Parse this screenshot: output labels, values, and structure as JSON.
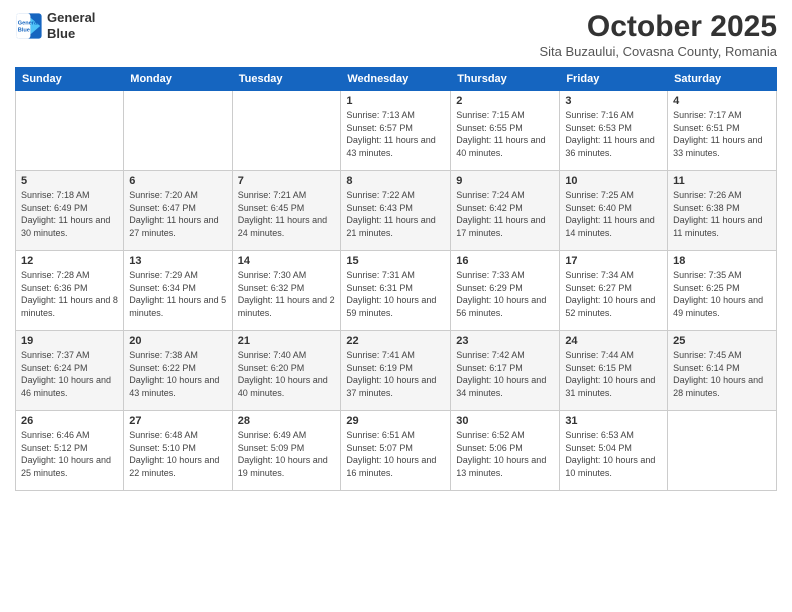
{
  "logo": {
    "line1": "General",
    "line2": "Blue"
  },
  "title": "October 2025",
  "subtitle": "Sita Buzaului, Covasna County, Romania",
  "days_of_week": [
    "Sunday",
    "Monday",
    "Tuesday",
    "Wednesday",
    "Thursday",
    "Friday",
    "Saturday"
  ],
  "weeks": [
    [
      {
        "day": "",
        "info": ""
      },
      {
        "day": "",
        "info": ""
      },
      {
        "day": "",
        "info": ""
      },
      {
        "day": "1",
        "info": "Sunrise: 7:13 AM\nSunset: 6:57 PM\nDaylight: 11 hours and 43 minutes."
      },
      {
        "day": "2",
        "info": "Sunrise: 7:15 AM\nSunset: 6:55 PM\nDaylight: 11 hours and 40 minutes."
      },
      {
        "day": "3",
        "info": "Sunrise: 7:16 AM\nSunset: 6:53 PM\nDaylight: 11 hours and 36 minutes."
      },
      {
        "day": "4",
        "info": "Sunrise: 7:17 AM\nSunset: 6:51 PM\nDaylight: 11 hours and 33 minutes."
      }
    ],
    [
      {
        "day": "5",
        "info": "Sunrise: 7:18 AM\nSunset: 6:49 PM\nDaylight: 11 hours and 30 minutes."
      },
      {
        "day": "6",
        "info": "Sunrise: 7:20 AM\nSunset: 6:47 PM\nDaylight: 11 hours and 27 minutes."
      },
      {
        "day": "7",
        "info": "Sunrise: 7:21 AM\nSunset: 6:45 PM\nDaylight: 11 hours and 24 minutes."
      },
      {
        "day": "8",
        "info": "Sunrise: 7:22 AM\nSunset: 6:43 PM\nDaylight: 11 hours and 21 minutes."
      },
      {
        "day": "9",
        "info": "Sunrise: 7:24 AM\nSunset: 6:42 PM\nDaylight: 11 hours and 17 minutes."
      },
      {
        "day": "10",
        "info": "Sunrise: 7:25 AM\nSunset: 6:40 PM\nDaylight: 11 hours and 14 minutes."
      },
      {
        "day": "11",
        "info": "Sunrise: 7:26 AM\nSunset: 6:38 PM\nDaylight: 11 hours and 11 minutes."
      }
    ],
    [
      {
        "day": "12",
        "info": "Sunrise: 7:28 AM\nSunset: 6:36 PM\nDaylight: 11 hours and 8 minutes."
      },
      {
        "day": "13",
        "info": "Sunrise: 7:29 AM\nSunset: 6:34 PM\nDaylight: 11 hours and 5 minutes."
      },
      {
        "day": "14",
        "info": "Sunrise: 7:30 AM\nSunset: 6:32 PM\nDaylight: 11 hours and 2 minutes."
      },
      {
        "day": "15",
        "info": "Sunrise: 7:31 AM\nSunset: 6:31 PM\nDaylight: 10 hours and 59 minutes."
      },
      {
        "day": "16",
        "info": "Sunrise: 7:33 AM\nSunset: 6:29 PM\nDaylight: 10 hours and 56 minutes."
      },
      {
        "day": "17",
        "info": "Sunrise: 7:34 AM\nSunset: 6:27 PM\nDaylight: 10 hours and 52 minutes."
      },
      {
        "day": "18",
        "info": "Sunrise: 7:35 AM\nSunset: 6:25 PM\nDaylight: 10 hours and 49 minutes."
      }
    ],
    [
      {
        "day": "19",
        "info": "Sunrise: 7:37 AM\nSunset: 6:24 PM\nDaylight: 10 hours and 46 minutes."
      },
      {
        "day": "20",
        "info": "Sunrise: 7:38 AM\nSunset: 6:22 PM\nDaylight: 10 hours and 43 minutes."
      },
      {
        "day": "21",
        "info": "Sunrise: 7:40 AM\nSunset: 6:20 PM\nDaylight: 10 hours and 40 minutes."
      },
      {
        "day": "22",
        "info": "Sunrise: 7:41 AM\nSunset: 6:19 PM\nDaylight: 10 hours and 37 minutes."
      },
      {
        "day": "23",
        "info": "Sunrise: 7:42 AM\nSunset: 6:17 PM\nDaylight: 10 hours and 34 minutes."
      },
      {
        "day": "24",
        "info": "Sunrise: 7:44 AM\nSunset: 6:15 PM\nDaylight: 10 hours and 31 minutes."
      },
      {
        "day": "25",
        "info": "Sunrise: 7:45 AM\nSunset: 6:14 PM\nDaylight: 10 hours and 28 minutes."
      }
    ],
    [
      {
        "day": "26",
        "info": "Sunrise: 6:46 AM\nSunset: 5:12 PM\nDaylight: 10 hours and 25 minutes."
      },
      {
        "day": "27",
        "info": "Sunrise: 6:48 AM\nSunset: 5:10 PM\nDaylight: 10 hours and 22 minutes."
      },
      {
        "day": "28",
        "info": "Sunrise: 6:49 AM\nSunset: 5:09 PM\nDaylight: 10 hours and 19 minutes."
      },
      {
        "day": "29",
        "info": "Sunrise: 6:51 AM\nSunset: 5:07 PM\nDaylight: 10 hours and 16 minutes."
      },
      {
        "day": "30",
        "info": "Sunrise: 6:52 AM\nSunset: 5:06 PM\nDaylight: 10 hours and 13 minutes."
      },
      {
        "day": "31",
        "info": "Sunrise: 6:53 AM\nSunset: 5:04 PM\nDaylight: 10 hours and 10 minutes."
      },
      {
        "day": "",
        "info": ""
      }
    ]
  ]
}
